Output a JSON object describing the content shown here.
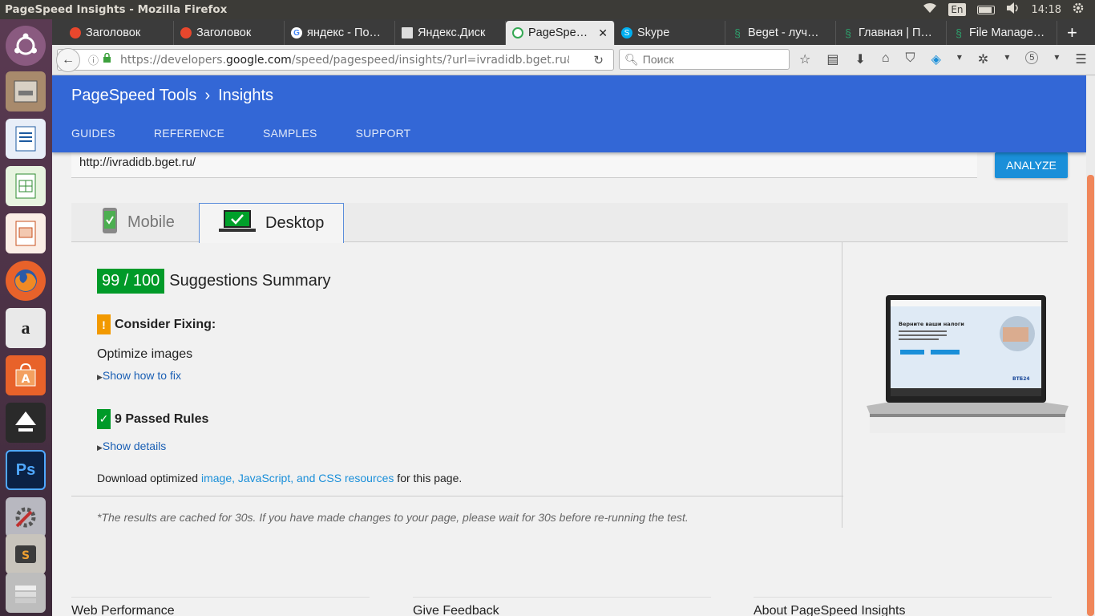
{
  "system": {
    "window_title": "PageSpeed Insights - Mozilla Firefox",
    "keyboard_layout": "En",
    "clock": "14:18"
  },
  "browser": {
    "tabs": [
      {
        "label": "Заголовок",
        "favicon_color": "#e8472d"
      },
      {
        "label": "Заголовок",
        "favicon_color": "#e8472d"
      },
      {
        "label": "яндекс - По…",
        "favicon_color": "#4285f4"
      },
      {
        "label": "Яндекс.Диск",
        "favicon_color": "#cccccc"
      },
      {
        "label": "PageSpe…",
        "favicon_color": "#34a853",
        "active": true
      },
      {
        "label": "Skype",
        "favicon_color": "#00aff0"
      },
      {
        "label": "Beget - луч…",
        "favicon_color": "#2e9e6b"
      },
      {
        "label": "Главная | П…",
        "favicon_color": "#2e9e6b"
      },
      {
        "label": "File Manage…",
        "favicon_color": "#2e9e6b"
      }
    ],
    "url_prefix": "https://developers.",
    "url_domain": "google.com",
    "url_suffix": "/speed/pagespeed/insights/?url=ivradidb.bget.ru&",
    "search_placeholder": "Поиск",
    "addon_badge": "5"
  },
  "header": {
    "brand": "PageSpeed Tools",
    "section": "Insights",
    "nav": [
      "GUIDES",
      "REFERENCE",
      "SAMPLES",
      "SUPPORT"
    ]
  },
  "form": {
    "url_value": "http://ivradidb.bget.ru/",
    "analyze_label": "ANALYZE"
  },
  "tabs": {
    "mobile": "Mobile",
    "desktop": "Desktop"
  },
  "results": {
    "score": "99 / 100",
    "summary_title": "Suggestions Summary",
    "consider_title": "Consider Fixing:",
    "consider_rule": "Optimize images",
    "show_fix": "Show how to fix",
    "passed_title": "9 Passed Rules",
    "show_details": "Show details",
    "download_prefix": "Download optimized ",
    "download_link": "image, JavaScript, and CSS resources",
    "download_suffix": " for this page.",
    "cache_note": "*The results are cached for 30s. If you have made changes to your page, please wait for 30s before re-running the test."
  },
  "preview": {
    "headline": "Верните ваши налоги",
    "bank_logo": "ВТБ24"
  },
  "footer": {
    "columns": [
      "Web Performance",
      "Give Feedback",
      "About PageSpeed Insights"
    ]
  },
  "colors": {
    "header_blue": "#3367d6",
    "score_green": "#009a29",
    "warning_orange": "#f29900",
    "analyze_blue": "#1a8fd9"
  }
}
